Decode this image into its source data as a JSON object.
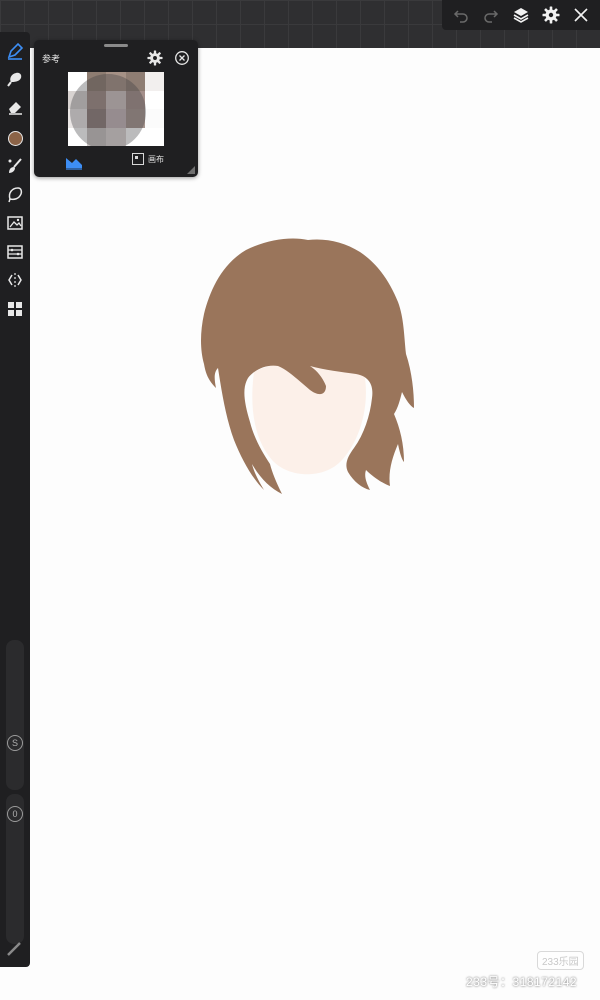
{
  "topbar": {
    "icons": [
      "undo-icon",
      "redo-icon",
      "layers-icon",
      "gear-icon",
      "close-icon"
    ]
  },
  "left_toolbar": {
    "icons": [
      "pen-tool-icon",
      "smudge-tool-icon",
      "eraser-icon",
      "color-swatch",
      "brush-icon",
      "lasso-icon",
      "image-transform-icon",
      "adjustments-icon",
      "symmetry-icon",
      "gallery-icon"
    ],
    "current_color": "#8b6347",
    "size_slider_label": "S",
    "opacity_slider_label": "0"
  },
  "reference_panel": {
    "title": "参考",
    "mode_label": "画布"
  },
  "colors": {
    "hair": "#9a755b",
    "skin": "#fcf0e9",
    "accent": "#3d8ef5",
    "toolbar_bg": "#1f1f21"
  },
  "watermark": {
    "badge": "233乐园",
    "text": "233号：318172142"
  }
}
